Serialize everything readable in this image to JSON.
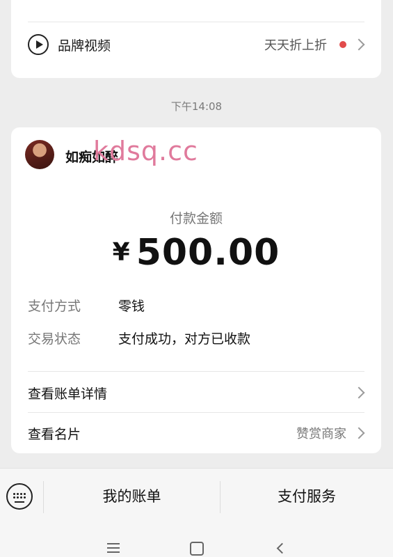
{
  "brand_row": {
    "label": "品牌视频",
    "right_text": "天天折上折"
  },
  "timestamp": "下午14:08",
  "payment": {
    "payee_name": "如痴如醉",
    "watermark": "kdsq.cc",
    "amount_label": "付款金额",
    "currency_symbol": "¥",
    "amount": "500.00",
    "method_key": "支付方式",
    "method_value": "零钱",
    "status_key": "交易状态",
    "status_value": "支付成功，对方已收款",
    "bill_detail_label": "查看账单详情",
    "card_label": "查看名片",
    "card_right_text": "赞赏商家"
  },
  "tabbar": {
    "tab1": "我的账单",
    "tab2": "支付服务"
  },
  "colors": {
    "background": "#ededed",
    "dot": "#e24b4b",
    "watermark": "#e07a9c"
  },
  "icons": [
    "play-icon",
    "chevron-right-icon",
    "keyboard-icon",
    "menu-icon",
    "home-icon",
    "back-icon"
  ]
}
